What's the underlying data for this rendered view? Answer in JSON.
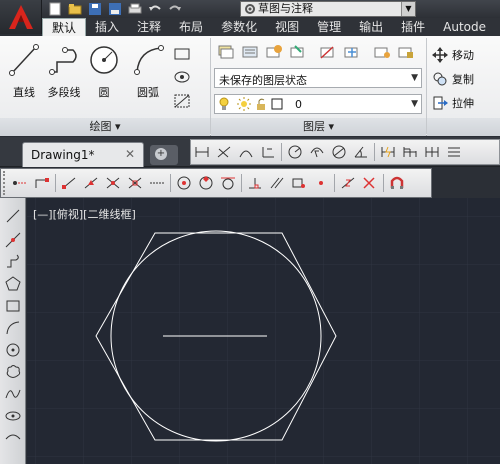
{
  "window": {
    "workspace": "草图与注释"
  },
  "ribbon": {
    "tabs": [
      "默认",
      "插入",
      "注释",
      "布局",
      "参数化",
      "视图",
      "管理",
      "输出",
      "插件",
      "Autode"
    ],
    "draw_panel": {
      "title": "绘图",
      "tools": [
        "直线",
        "多段线",
        "圆",
        "圆弧"
      ]
    },
    "layer_panel": {
      "title": "图层",
      "layer_state": "未保存的图层状态",
      "current_layer": "0"
    },
    "modify_panel": {
      "items": [
        "移动",
        "复制",
        "拉伸"
      ]
    }
  },
  "filebar": {
    "file_tab": "Drawing1*",
    "close_glyph": "✕"
  },
  "viewport": {
    "label": "[—][俯视][二维线框]"
  },
  "colors": {
    "canvas_bg": "#232833",
    "grid": "#2f3541",
    "geometry": "#ffffff",
    "app_icon": "#d9251c"
  }
}
